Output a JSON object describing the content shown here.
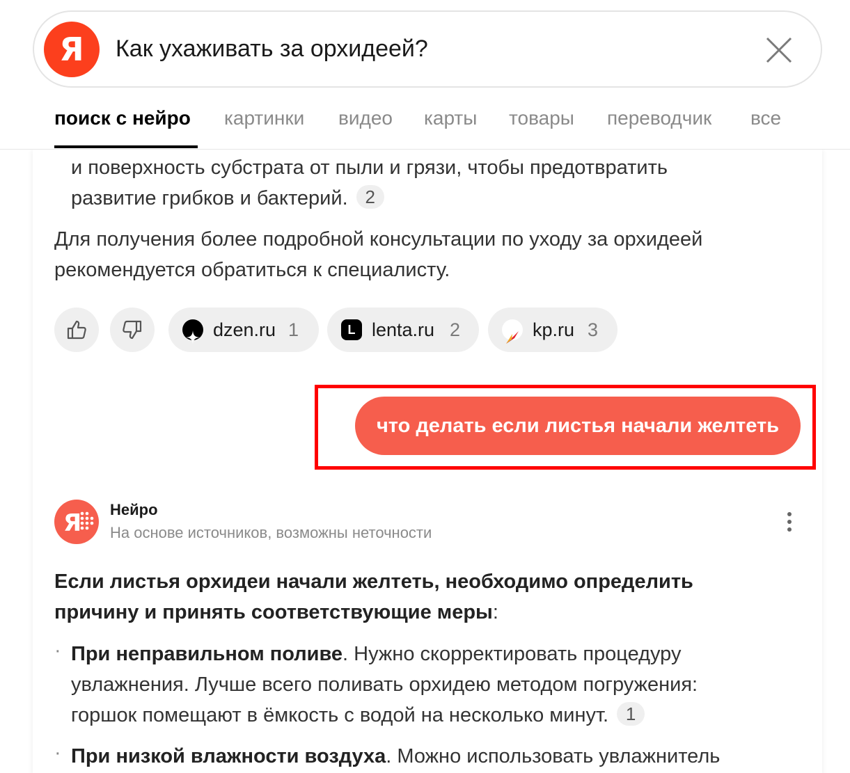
{
  "search": {
    "logo_letter": "Я",
    "query": "Как ухаживать за орхидеей?"
  },
  "tabs": [
    {
      "label": "поиск с нейро",
      "active": true
    },
    {
      "label": "картинки"
    },
    {
      "label": "видео"
    },
    {
      "label": "карты"
    },
    {
      "label": "товары"
    },
    {
      "label": "переводчик"
    },
    {
      "label": "все"
    }
  ],
  "answer_prev": {
    "line1": "и поверхность субстрата от пыли и грязи, чтобы предотвратить",
    "line2": "развитие грибков и бактерий.",
    "line2_ref": "2",
    "para_line1": "Для получения более подробной консультации по уходу за орхидеей",
    "para_line2": "рекомендуется обратиться к специалисту."
  },
  "sources": [
    {
      "name": "dzen.ru",
      "num": "1",
      "icon": "dzen-icon"
    },
    {
      "name": "lenta.ru",
      "num": "2",
      "icon": "lenta-icon"
    },
    {
      "name": "kp.ru",
      "num": "3",
      "icon": "kp-icon"
    }
  ],
  "suggestion": {
    "label": "что делать если листья начали желтеть"
  },
  "neiro": {
    "name": "Нейро",
    "subtitle": "На основе источников, возможны неточности"
  },
  "answer": {
    "intro_line1": "Если листья орхидеи начали желтеть, необходимо определить",
    "intro_line2_bold": "причину и принять соответствующие меры",
    "intro_line2_tail": ":",
    "b1_title": "При неправильном поливе",
    "b1_line1_tail": ". Нужно скорректировать процедуру",
    "b1_line2": "увлажнения. Лучше всего поливать орхидею методом погружения:",
    "b1_line3": "горшок помещают в ёмкость с водой на несколько минут.",
    "b1_ref": "1",
    "b2_title": "При низкой влажности воздуха",
    "b2_line1_tail": ". Можно использовать увлажнитель"
  },
  "colors": {
    "accent": "#f65e4d",
    "yandex_red": "#fc3f1d",
    "highlight": "#ff0000"
  }
}
